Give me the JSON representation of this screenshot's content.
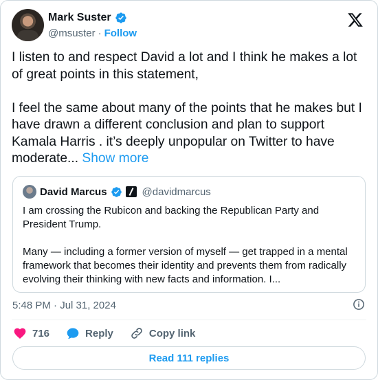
{
  "author": {
    "name": "Mark Suster",
    "handle": "@msuster",
    "separator": "·",
    "follow_label": "Follow"
  },
  "tweet": {
    "paragraph1": "I listen to and respect David a lot and I think he makes a lot of great points in this statement,",
    "paragraph2": "I feel the same about many of the points that he makes but I have drawn a different conclusion and plan to support Kamala Harris . it’s deeply unpopular on Twitter to have moderate...",
    "show_more": "Show more"
  },
  "quoted": {
    "name": "David Marcus",
    "handle": "@davidmarcus",
    "paragraph1": "I am crossing the Rubicon and backing the Republican Party and President Trump.",
    "paragraph2": "Many — including a former version of myself — get trapped in a mental framework that becomes their identity and prevents them from radically evolving their thinking with new facts and information. I..."
  },
  "timestamp": "5:48 PM · Jul 31, 2024",
  "actions": {
    "like_count": "716",
    "reply_label": "Reply",
    "copy_label": "Copy link"
  },
  "read_replies_label": "Read 111 replies",
  "colors": {
    "accent": "#1d9bf0",
    "like": "#f91880",
    "text": "#0f1419",
    "muted": "#536471"
  }
}
